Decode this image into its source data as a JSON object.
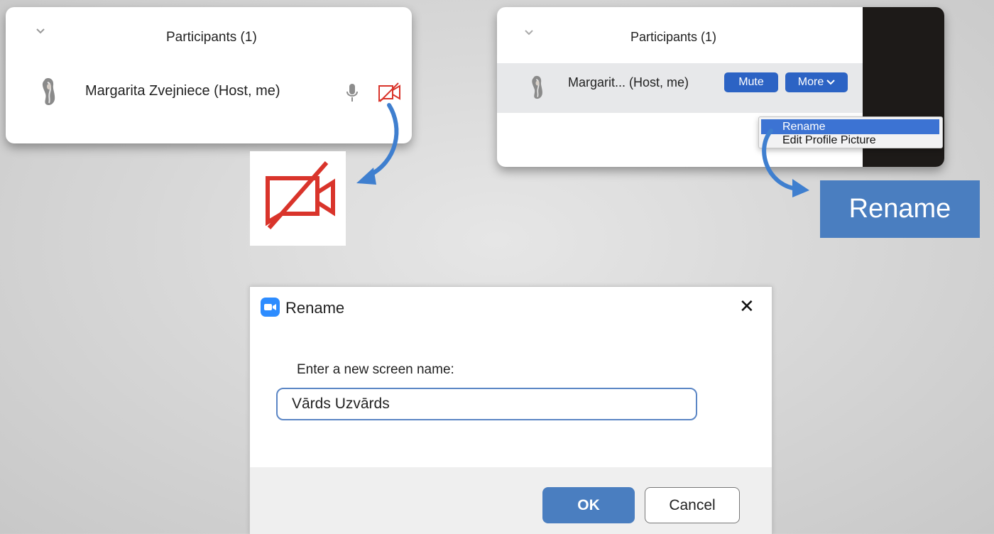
{
  "left_panel": {
    "title": "Participants (1)",
    "participant_name": "Margarita Zvejniece (Host, me)"
  },
  "right_panel": {
    "title": "Participants (1)",
    "participant_name": "Margarit... (Host, me)",
    "mute_label": "Mute",
    "more_label": "More",
    "menu_items": [
      "Rename",
      "Edit Profile Picture"
    ]
  },
  "callout": {
    "label": "Rename"
  },
  "dialog": {
    "title": "Rename",
    "close_glyph": "✕",
    "prompt": "Enter a new screen name:",
    "input_value": "Vārds Uzvārds",
    "ok_label": "OK",
    "cancel_label": "Cancel"
  },
  "icons": {
    "chevron": "chevron-down-icon",
    "avatar": "avatar-icon",
    "mic": "microphone-icon",
    "video_off": "video-off-icon",
    "app": "zoom-camera-icon",
    "close": "close-icon",
    "arrow": "curved-arrow-icon"
  },
  "colors": {
    "accent_blue": "#2c63c4",
    "callout_blue": "#4a7ec0",
    "video_off_red": "#d9342b"
  }
}
